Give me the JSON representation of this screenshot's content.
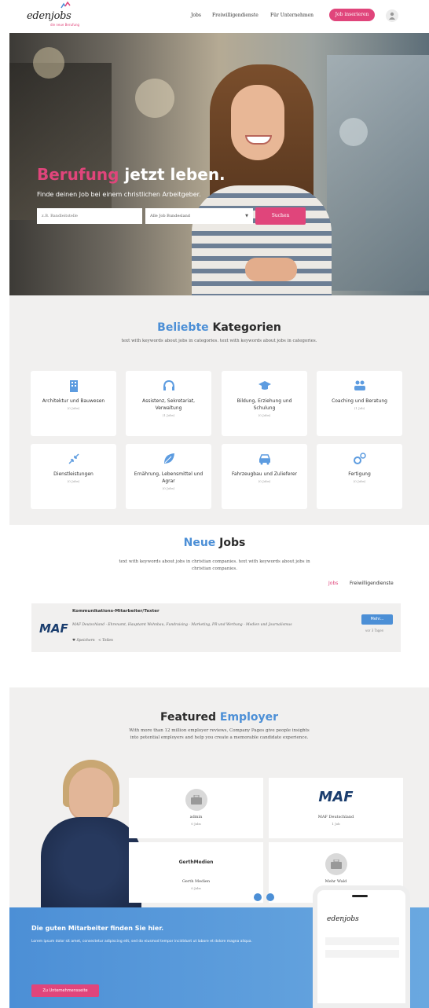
{
  "header": {
    "logo_text": "edenjobs",
    "logo_tagline": "die neue Berufung",
    "nav": [
      "Jobs",
      "Freiwilligendienste",
      "Für Unternehmen"
    ],
    "job_button": "Job inserieren"
  },
  "hero": {
    "title_accent": "Berufung",
    "title_rest": " jetzt leben.",
    "subtitle": "Finde deinen Job bei einem christlichen Arbeitgeber.",
    "search_placeholder": "z.B. Bandleitstelle",
    "location_value": "Alle Job Bundesland",
    "search_button": "Suchen"
  },
  "categories": {
    "title_accent": "Beliebte",
    "title_rest": " Kategorien",
    "description": "text with keywords about jobs in categories. text with keywords about jobs in categories.",
    "items": [
      {
        "label": "Architektur und Bauwesen",
        "count": "(0 Jobs)",
        "icon": "building-icon"
      },
      {
        "label": "Assistenz, Sekretariat, Verwaltung",
        "count": "(1 Jobs)",
        "icon": "headset-icon"
      },
      {
        "label": "Bildung, Erziehung und Schulung",
        "count": "(0 Jobs)",
        "icon": "graduation-cap-icon"
      },
      {
        "label": "Coaching und Beratung",
        "count": "(1 Job)",
        "icon": "people-icon"
      },
      {
        "label": "Dienstleistungen",
        "count": "(0 Jobs)",
        "icon": "arrows-icon"
      },
      {
        "label": "Ernährung, Lebensmittel und Agrar",
        "count": "(0 Jobs)",
        "icon": "leaf-icon"
      },
      {
        "label": "Fahrzeugbau und Zulieferer",
        "count": "(0 Jobs)",
        "icon": "car-icon"
      },
      {
        "label": "Fertigung",
        "count": "(0 Jobs)",
        "icon": "gears-icon"
      }
    ]
  },
  "jobs": {
    "title_accent": "Neue",
    "title_rest": " Jobs",
    "description": "text with keywords about jobs in christian companies. text with keywords about jobs in christian companies.",
    "tab_jobs": "Jobs",
    "tab_frei": "Freiwilligendienste",
    "listing": {
      "logo": "MAF",
      "title": "Kommunikations-Mitarbeiter/Texter",
      "meta": "MAF Deutschland · Ehrenamt, Hauptamt Wohnbau, Fundraising - Marketing, PR und Werbung - Medien und Journalismus",
      "save": "♥ Speichern",
      "share": "< Teilen",
      "more_button": "Mehr...",
      "date": "vor 3 Tagen"
    }
  },
  "featured": {
    "title": "Featured",
    "title_accent": " Employer",
    "description": "With more than 12 million employer reviews, Company Pages give people insights into potential employers and help you create a memorable candidate experience.",
    "employers": [
      {
        "name": "admin",
        "count": "0 Jobs",
        "logo": ""
      },
      {
        "name": "MAF Deutschland",
        "count": "1 Job",
        "logo": "MAF"
      },
      {
        "name": "Gerth Medien",
        "count": "0 Jobs",
        "logo": "GerthMedien"
      },
      {
        "name": "Mehr Wald",
        "count": "0 Jobs",
        "logo": ""
      }
    ]
  },
  "banner": {
    "title": "Die guten Mitarbeiter finden Sie hier.",
    "text": "Lorem ipsum dolor sit amet, consectetur adipiscing elit, sed do eiusmod tempor incididunt ut labore et dolore magna aliqua.",
    "button": "Zu Unternehmensseite",
    "phone_logo": "edenjobs"
  },
  "colors": {
    "accent_pink": "#e0457b",
    "accent_blue": "#4c8fd6"
  }
}
